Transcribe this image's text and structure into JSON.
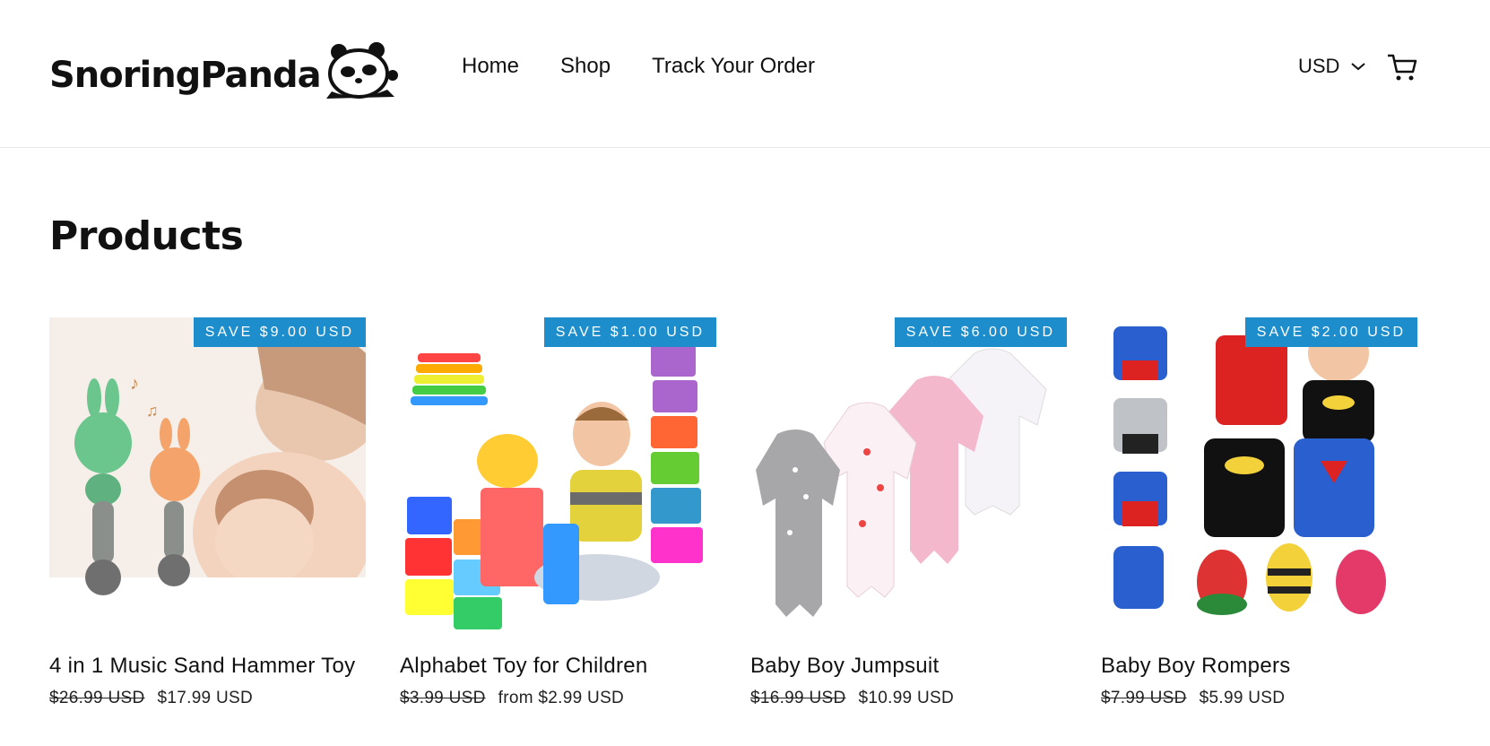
{
  "brand": {
    "name": "SnoringPanda"
  },
  "nav": {
    "items": [
      "Home",
      "Shop",
      "Track Your Order"
    ]
  },
  "currency": {
    "selected": "USD"
  },
  "page": {
    "title": "Products"
  },
  "colors": {
    "badge": "#1d8ecb",
    "text": "#111111"
  },
  "products": [
    {
      "title": "4 in 1 Music Sand Hammer Toy",
      "badge": "SAVE $9.00 USD",
      "price_old": "$26.99 USD",
      "price_new": "$17.99 USD"
    },
    {
      "title": "Alphabet Toy for Children",
      "badge": "SAVE $1.00 USD",
      "price_old": "$3.99 USD",
      "price_new": "from $2.99 USD"
    },
    {
      "title": "Baby Boy Jumpsuit",
      "badge": "SAVE $6.00 USD",
      "price_old": "$16.99 USD",
      "price_new": "$10.99 USD"
    },
    {
      "title": "Baby Boy Rompers",
      "badge": "SAVE $2.00 USD",
      "price_old": "$7.99 USD",
      "price_new": "$5.99 USD"
    }
  ]
}
